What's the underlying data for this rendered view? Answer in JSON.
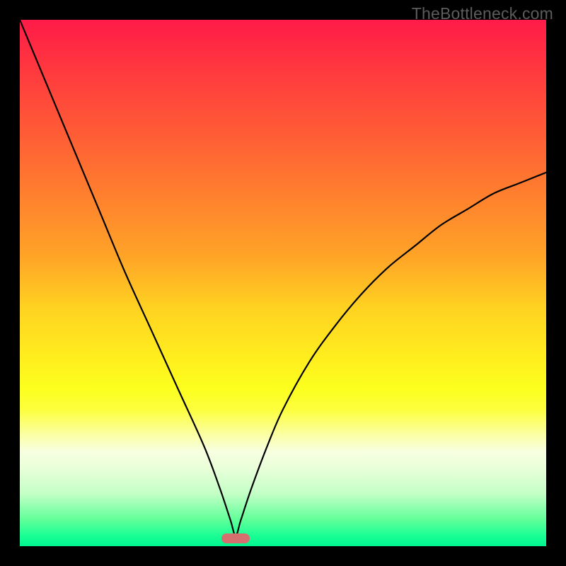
{
  "watermark": "TheBottleneck.com",
  "colors": {
    "frame": "#000000",
    "curve": "#000000",
    "marker": "#d6706e",
    "gradient_top": "#ff1b48",
    "gradient_bottom": "#00f590"
  },
  "chart_data": {
    "type": "line",
    "title": "",
    "xlabel": "",
    "ylabel": "",
    "xlim": [
      0,
      100
    ],
    "ylim": [
      0,
      100
    ],
    "grid": false,
    "legend": false,
    "min_point": {
      "x": 41,
      "y": 1.5
    },
    "series": [
      {
        "name": "bottleneck-curve",
        "x": [
          0,
          5,
          10,
          15,
          20,
          25,
          30,
          35,
          38,
          40,
          41,
          42,
          44,
          47,
          50,
          55,
          60,
          65,
          70,
          75,
          80,
          85,
          90,
          95,
          100
        ],
        "y": [
          100,
          88,
          76,
          64,
          52,
          41,
          30,
          19,
          11,
          5,
          2,
          5,
          11,
          19,
          26,
          35,
          42,
          48,
          53,
          57,
          61,
          64,
          67,
          69,
          71
        ]
      }
    ],
    "annotations": [
      {
        "type": "marker",
        "shape": "pill",
        "x": 41,
        "y": 1.5
      }
    ]
  }
}
